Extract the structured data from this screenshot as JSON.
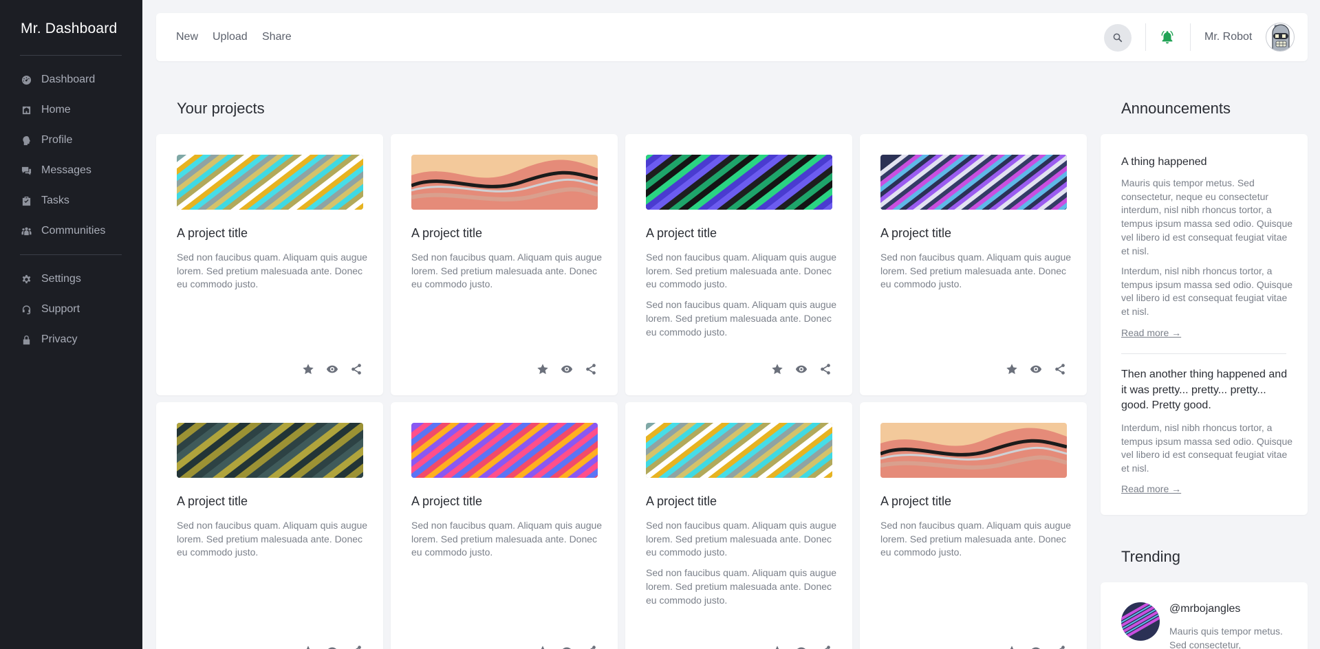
{
  "sidebar": {
    "brand": "Mr. Dashboard",
    "nav": [
      {
        "label": "Dashboard",
        "icon": "dashboard-icon"
      },
      {
        "label": "Home",
        "icon": "home-icon"
      },
      {
        "label": "Profile",
        "icon": "profile-icon"
      },
      {
        "label": "Messages",
        "icon": "messages-icon"
      },
      {
        "label": "Tasks",
        "icon": "tasks-icon"
      },
      {
        "label": "Communities",
        "icon": "communities-icon"
      }
    ],
    "secondary": [
      {
        "label": "Settings",
        "icon": "gear-icon"
      },
      {
        "label": "Support",
        "icon": "headset-icon"
      },
      {
        "label": "Privacy",
        "icon": "lock-icon"
      }
    ]
  },
  "topbar": {
    "links": [
      "New",
      "Upload",
      "Share"
    ],
    "user_name": "Mr. Robot"
  },
  "projects": {
    "heading": "Your projects",
    "cards": [
      {
        "title": "A project title",
        "paragraphs": [
          "Sed non faucibus quam. Aliquam quis augue lorem. Sed pretium malesuada ante. Donec eu commodo justo."
        ],
        "thumb": "teal-gold"
      },
      {
        "title": "A project title",
        "paragraphs": [
          "Sed non faucibus quam. Aliquam quis augue lorem. Sed pretium malesuada ante. Donec eu commodo justo."
        ],
        "thumb": "peach-wave"
      },
      {
        "title": "A project title",
        "paragraphs": [
          "Sed non faucibus quam. Aliquam quis augue lorem. Sed pretium malesuada ante. Donec eu commodo justo.",
          "Sed non faucibus quam. Aliquam quis augue lorem. Sed pretium malesuada ante. Donec eu commodo justo."
        ],
        "thumb": "dark-green"
      },
      {
        "title": "A project title",
        "paragraphs": [
          "Sed non faucibus quam. Aliquam quis augue lorem. Sed pretium malesuada ante. Donec eu commodo justo."
        ],
        "thumb": "navy-purple"
      },
      {
        "title": "A project title",
        "paragraphs": [
          "Sed non faucibus quam. Aliquam quis augue lorem. Sed pretium malesuada ante. Donec eu commodo justo."
        ],
        "thumb": "dark-olive"
      },
      {
        "title": "A project title",
        "paragraphs": [
          "Sed non faucibus quam. Aliquam quis augue lorem. Sed pretium malesuada ante. Donec eu commodo justo."
        ],
        "thumb": "violet-red"
      },
      {
        "title": "A project title",
        "paragraphs": [
          "Sed non faucibus quam. Aliquam quis augue lorem. Sed pretium malesuada ante. Donec eu commodo justo.",
          "Sed non faucibus quam. Aliquam quis augue lorem. Sed pretium malesuada ante. Donec eu commodo justo."
        ],
        "thumb": "teal-gold"
      },
      {
        "title": "A project title",
        "paragraphs": [
          "Sed non faucibus quam. Aliquam quis augue lorem. Sed pretium malesuada ante. Donec eu commodo justo."
        ],
        "thumb": "peach-wave"
      }
    ],
    "actions": [
      "star-icon",
      "eye-icon",
      "share-icon"
    ]
  },
  "announcements": {
    "heading": "Announcements",
    "items": [
      {
        "title": "A thing happened",
        "paragraphs": [
          "Mauris quis tempor metus. Sed consectetur, neque eu consectetur interdum, nisl nibh rhoncus tortor, a tempus ipsum massa sed odio. Quisque vel libero id est consequat feugiat vitae et nisl.",
          "Interdum, nisl nibh rhoncus tortor, a tempus ipsum massa sed odio. Quisque vel libero id est consequat feugiat vitae et nisl."
        ],
        "link": "Read more →"
      },
      {
        "title": "Then another thing happened and it was pretty... pretty... pretty... good. Pretty good.",
        "paragraphs": [
          "Interdum, nisl nibh rhoncus tortor, a tempus ipsum massa sed odio. Quisque vel libero id est consequat feugiat vitae et nisl."
        ],
        "link": "Read more →"
      }
    ]
  },
  "trending": {
    "heading": "Trending",
    "handle": "@mrbojangles",
    "text": "Mauris quis tempor metus. Sed consectetur,"
  },
  "colors": {
    "sidebar_bg": "#1c1e24",
    "page_bg": "#f3f4f7",
    "bell": "#22a356"
  }
}
